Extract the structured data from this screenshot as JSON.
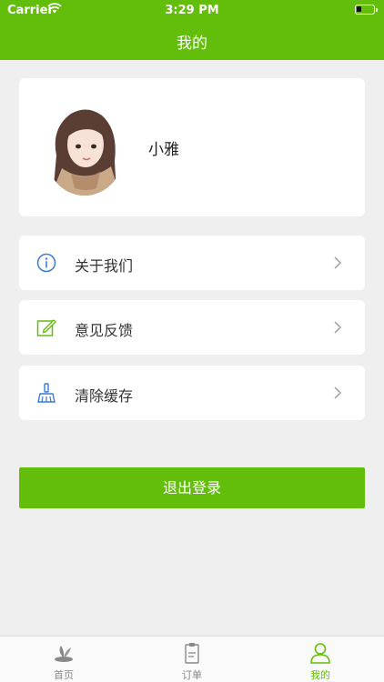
{
  "status_bar": {
    "carrier": "Carrier",
    "time": "3:29 PM",
    "battery_level": 0.3
  },
  "nav": {
    "title": "我的"
  },
  "profile": {
    "username": "小雅"
  },
  "menu": [
    {
      "label": "关于我们",
      "icon": "info-icon"
    },
    {
      "label": "意见反馈",
      "icon": "edit-icon"
    },
    {
      "label": "清除缓存",
      "icon": "broom-icon"
    }
  ],
  "logout_label": "退出登录",
  "tabs": [
    {
      "label": "首页",
      "icon": "home-icon",
      "active": false
    },
    {
      "label": "订单",
      "icon": "clipboard-icon",
      "active": false
    },
    {
      "label": "我的",
      "icon": "user-icon",
      "active": true
    }
  ],
  "colors": {
    "accent": "#63bd0b",
    "background": "#efefef",
    "info_icon": "#3a7bd5"
  }
}
